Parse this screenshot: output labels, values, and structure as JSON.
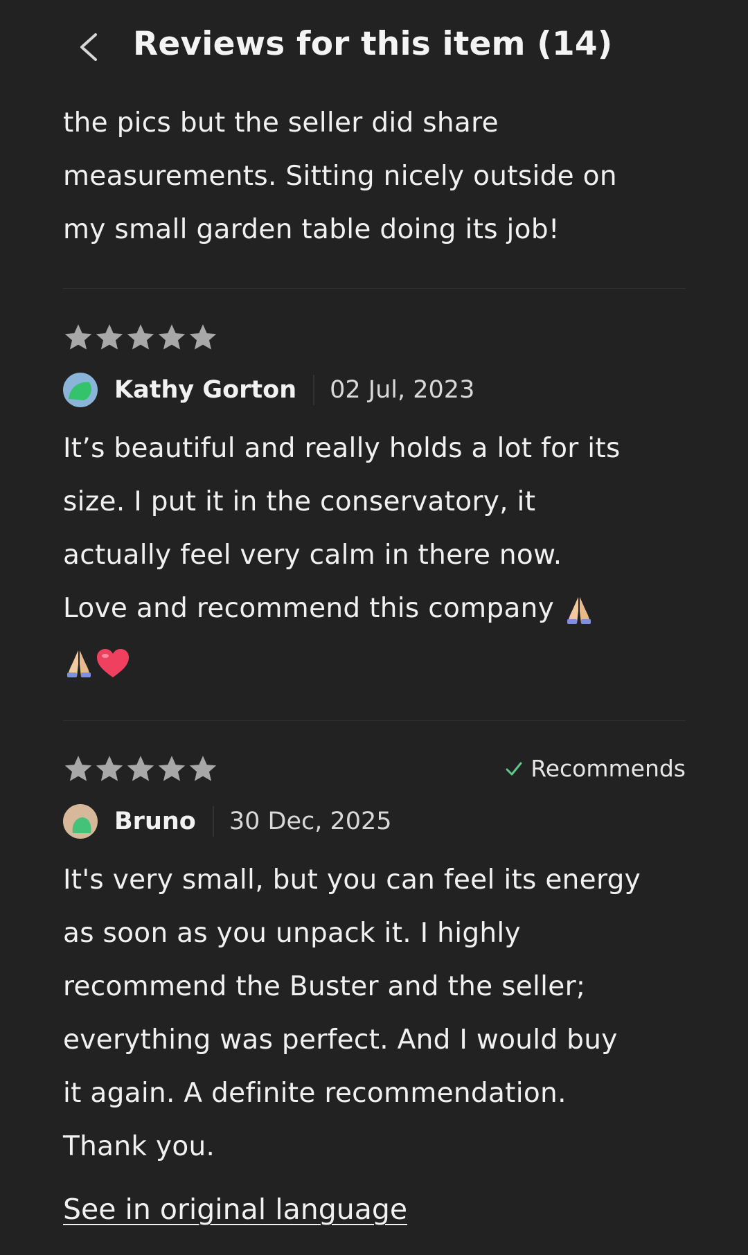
{
  "header": {
    "title": "Reviews for this item (14)",
    "back_icon": "chevron-left-icon"
  },
  "reviews": [
    {
      "partial": true,
      "text_lines": [
        "the pics but the seller did share",
        "measurements. Sitting nicely outside on",
        "my small garden table doing its job!"
      ]
    },
    {
      "rating": 5,
      "recommends": false,
      "reviewer": "Kathy Gorton",
      "date": "02 Jul, 2023",
      "avatar_colors": [
        "#8ab4d8",
        "#34c26a"
      ],
      "text_lines": [
        "It’s beautiful and really holds a lot for its",
        "size. I put it in the conservatory, it",
        "actually feel very calm in there now.",
        "Love and recommend this company"
      ],
      "emojis": [
        "folded-hands-icon",
        "folded-hands-icon",
        "red-heart-icon"
      ]
    },
    {
      "rating": 5,
      "recommends": true,
      "recommends_label": "Recommends",
      "reviewer": "Bruno",
      "date": "30 Dec, 2025",
      "avatar_colors": [
        "#d8b89a",
        "#45c27a"
      ],
      "text_lines": [
        "It's very small, but you can feel its energy",
        "as soon as you unpack it. I highly",
        "recommend the Buster and the seller;",
        "everything was perfect. And I would buy",
        "it again. A definite recommendation.",
        "Thank you."
      ],
      "translate_link": "See in original language"
    }
  ],
  "colors": {
    "background": "#222222",
    "text": "#f1f1f1",
    "star": "#a8a8a8",
    "check": "#5fc98a",
    "divider": "#2f2f2f"
  }
}
